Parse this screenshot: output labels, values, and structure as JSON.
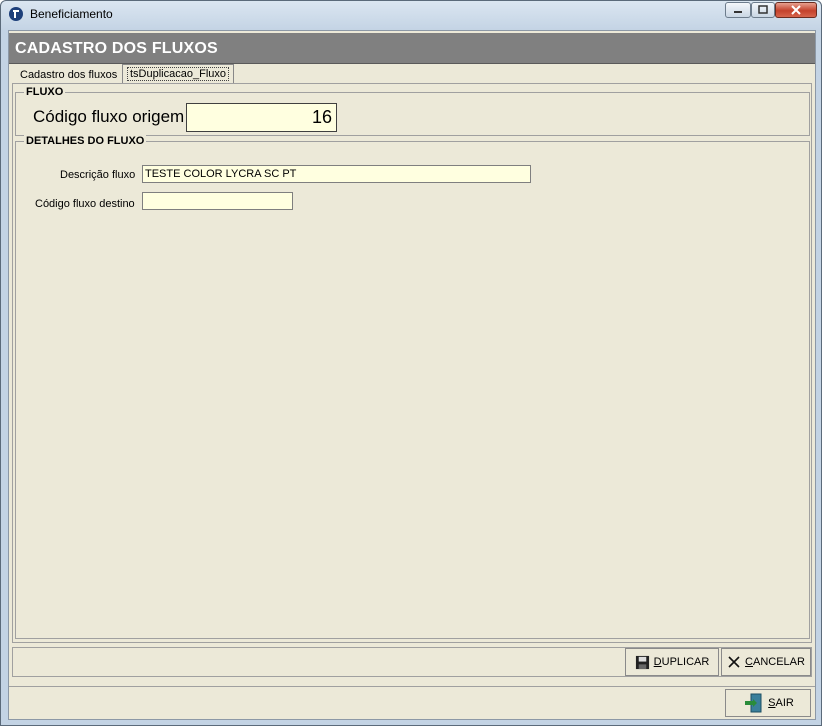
{
  "window": {
    "title": "Beneficiamento"
  },
  "form": {
    "title": "CADASTRO DOS FLUXOS"
  },
  "tabs": [
    {
      "label": "Cadastro dos fluxos"
    },
    {
      "label": "tsDuplicacao_Fluxo"
    }
  ],
  "fluxo_group": {
    "legend": "FLUXO",
    "origem_label": "Código fluxo origem",
    "origem_value": "16"
  },
  "detalhes_group": {
    "legend": "DETALHES DO FLUXO",
    "descricao_label": "Descrição fluxo",
    "descricao_value": "TESTE COLOR LYCRA SC PT",
    "destino_label": "Código fluxo destino",
    "destino_value": ""
  },
  "buttons": {
    "duplicar_first": "D",
    "duplicar_rest": "UPLICAR",
    "cancelar_first": "C",
    "cancelar_rest": "ANCELAR",
    "sair_first": "S",
    "sair_rest": "AIR"
  },
  "icons": {
    "duplicar": "floppy-disk-icon",
    "cancelar": "x-icon",
    "sair": "exit-door-icon"
  },
  "colors": {
    "header_bg": "#808080",
    "input_bg": "#ffffe0",
    "client_bg": "#ece9d8"
  }
}
